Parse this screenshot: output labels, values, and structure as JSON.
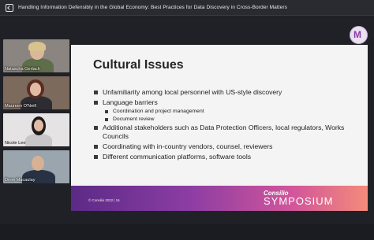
{
  "window": {
    "title": "Handling Information Defensibly in the Global Economy: Best Practices for Data Discovery in Cross-Border Matters"
  },
  "participants": [
    {
      "name": "Natascha Gerlach"
    },
    {
      "name": "Maureen O'Neill"
    },
    {
      "name": "Nicole Lee"
    },
    {
      "name": "Drew Macaulay"
    }
  ],
  "slide": {
    "title": "Cultural Issues",
    "bullets": [
      {
        "text": "Unfamiliarity among local personnel with US-style discovery",
        "sub": []
      },
      {
        "text": "Language barriers",
        "sub": [
          "Coordination and project management",
          "Document review"
        ]
      },
      {
        "text": "Additional stakeholders such as Data Protection Officers, local regulators, Works Councils",
        "sub": []
      },
      {
        "text": "Coordinating with in-country vendors, counsel, reviewers",
        "sub": []
      },
      {
        "text": "Different communication platforms, software tools",
        "sub": []
      }
    ],
    "footer_text": "© Consilio 2022  |  16",
    "brand_top": "Consilio",
    "brand_main": "SYMPOSIUM"
  },
  "icons": {
    "back": "back-icon",
    "app_logo": "symposium-logo-icon"
  }
}
